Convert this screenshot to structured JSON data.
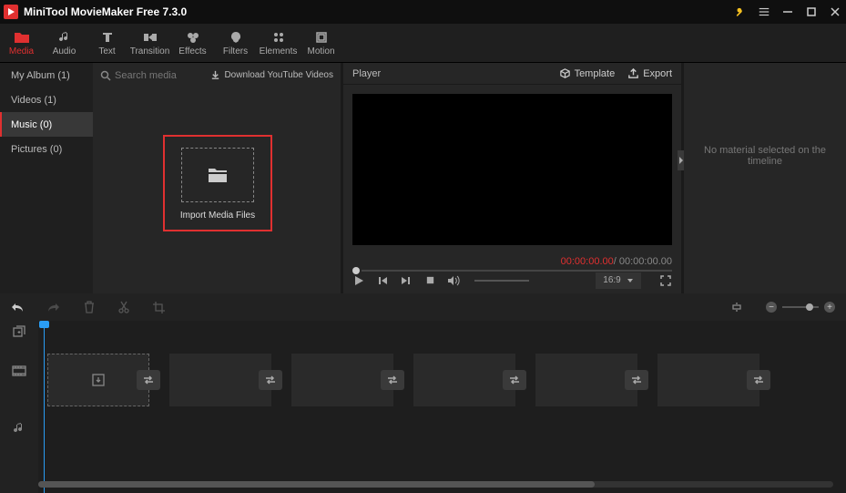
{
  "titlebar": {
    "title": "MiniTool MovieMaker Free 7.3.0"
  },
  "toolbar": [
    {
      "label": "Media",
      "active": true
    },
    {
      "label": "Audio"
    },
    {
      "label": "Text"
    },
    {
      "label": "Transition"
    },
    {
      "label": "Effects"
    },
    {
      "label": "Filters"
    },
    {
      "label": "Elements"
    },
    {
      "label": "Motion"
    }
  ],
  "sidebar": [
    {
      "label": "My Album (1)"
    },
    {
      "label": "Videos (1)"
    },
    {
      "label": "Music (0)",
      "active": true
    },
    {
      "label": "Pictures (0)"
    }
  ],
  "media": {
    "search_placeholder": "Search media",
    "download_label": "Download YouTube Videos",
    "import_label": "Import Media Files"
  },
  "player": {
    "title": "Player",
    "template_label": "Template",
    "export_label": "Export",
    "current_time": "00:00:00.00",
    "total_time": "00:00:00.00",
    "separator": " / ",
    "ratio": "16:9"
  },
  "right": {
    "message": "No material selected on the timeline"
  }
}
